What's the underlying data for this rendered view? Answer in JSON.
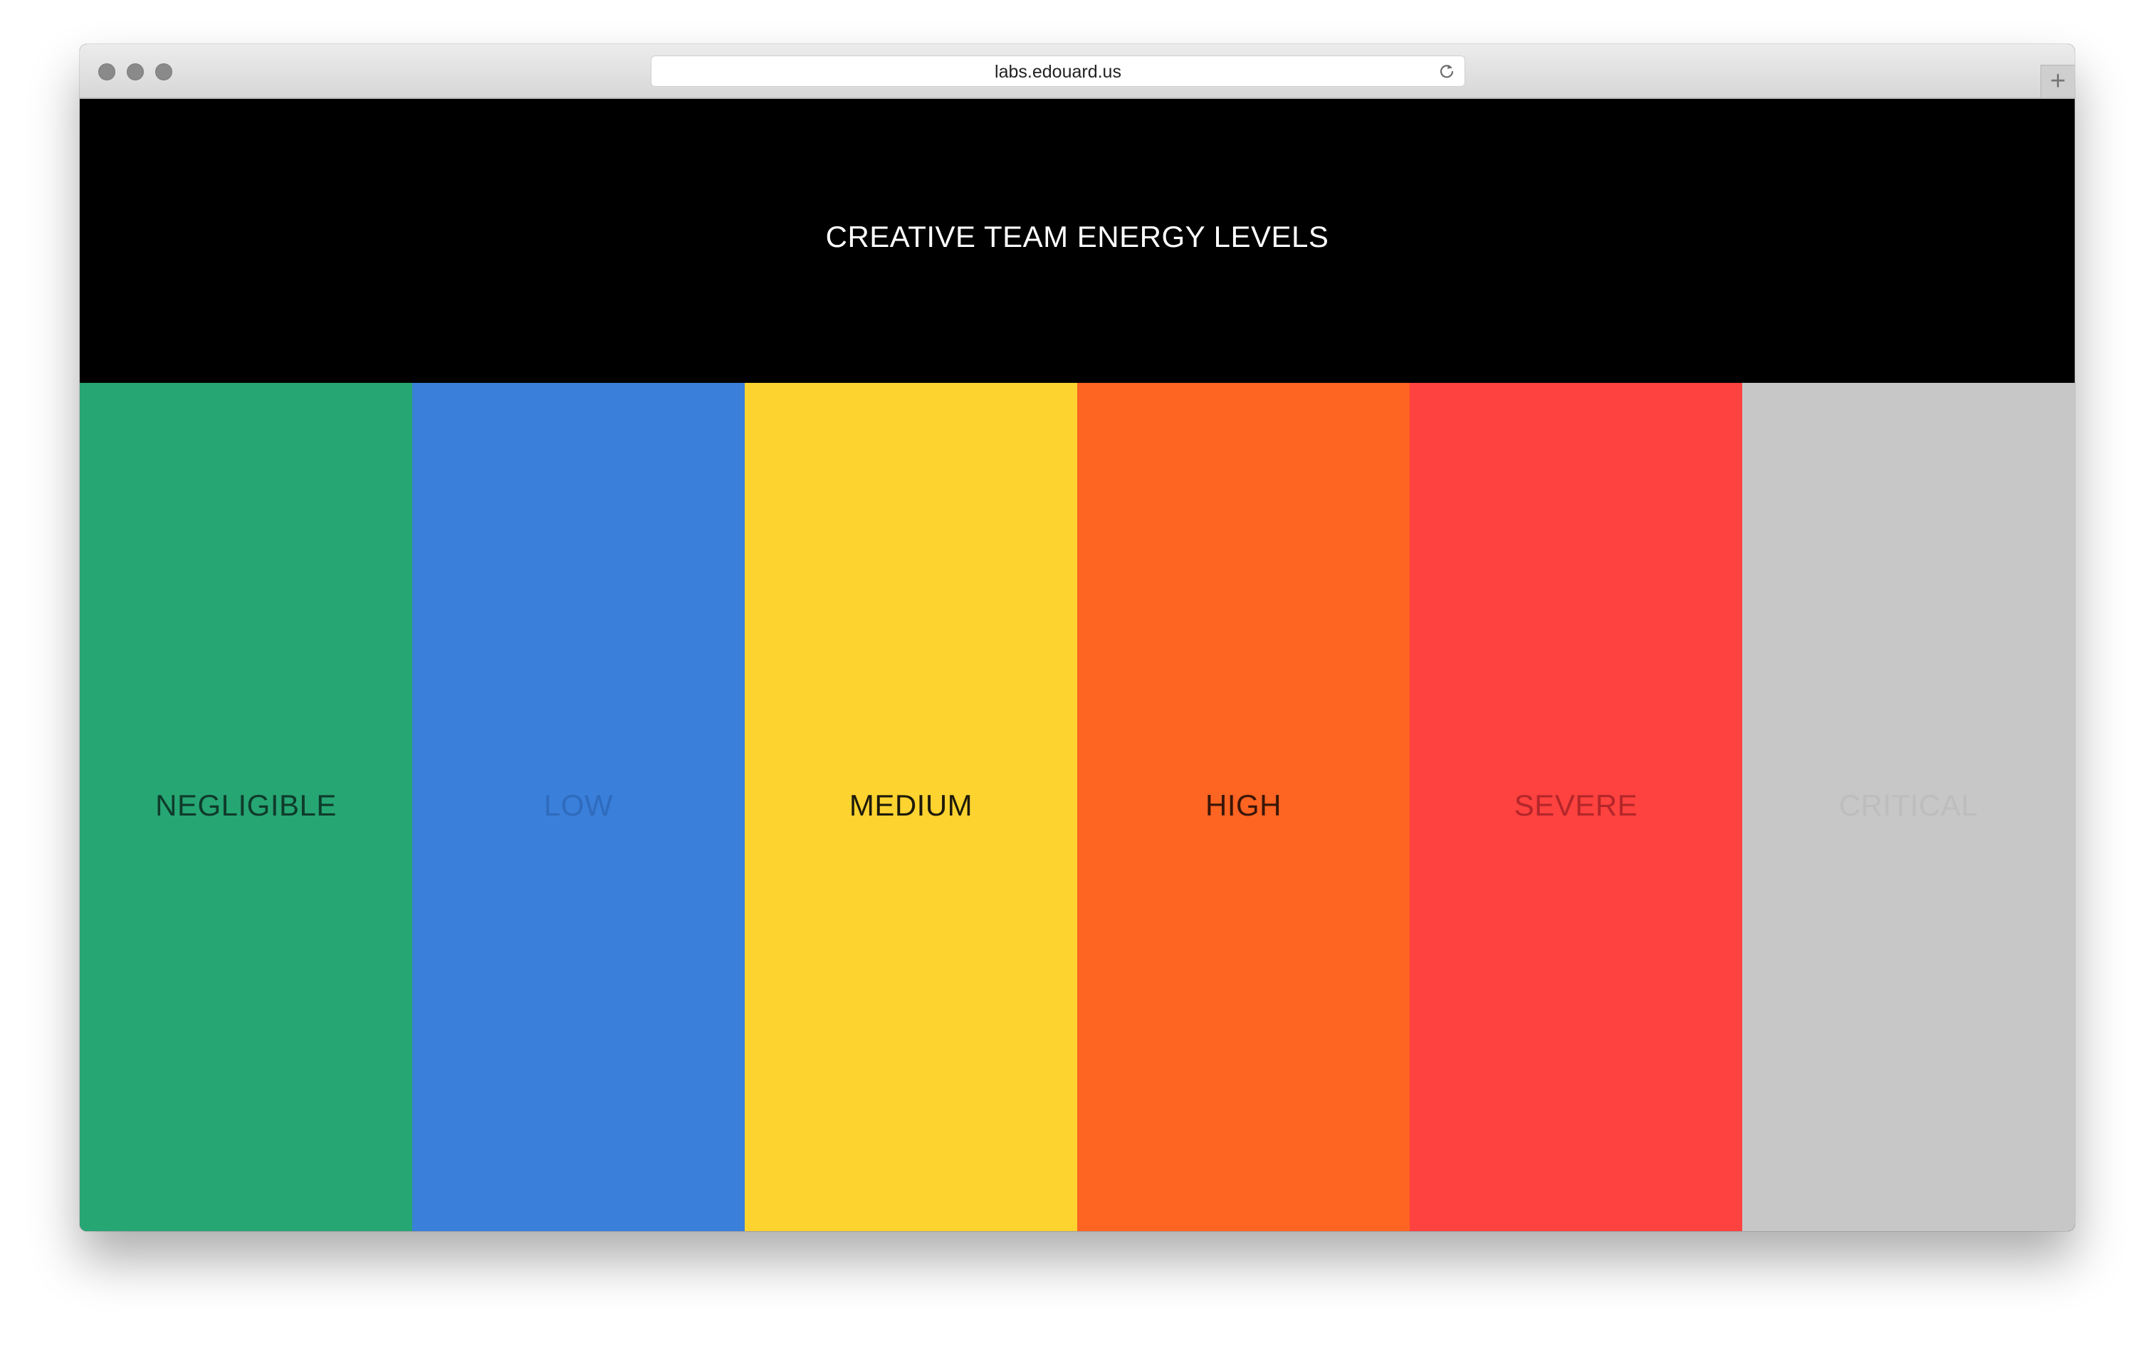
{
  "browser": {
    "url": "labs.edouard.us",
    "new_tab_symbol": "+",
    "icons": [
      "close-icon",
      "minimize-icon",
      "zoom-icon",
      "reload-icon",
      "plus-icon"
    ]
  },
  "page": {
    "title": "CREATIVE TEAM ENERGY LEVELS"
  },
  "levels": [
    {
      "label": "NEGLIGIBLE",
      "background": "#26a673",
      "text_color": "#0f3b2b"
    },
    {
      "label": "LOW",
      "background": "#3a7fd9",
      "text_color": "#2f6bbd"
    },
    {
      "label": "MEDIUM",
      "background": "#fdd330",
      "text_color": "#1e1a0a"
    },
    {
      "label": "HIGH",
      "background": "#fe6422",
      "text_color": "#3a1607"
    },
    {
      "label": "SEVERE",
      "background": "#fe423f",
      "text_color": "#b3262a"
    },
    {
      "label": "CRITICAL",
      "background": "#c7c7c7",
      "text_color": "#bdbdbd"
    }
  ]
}
